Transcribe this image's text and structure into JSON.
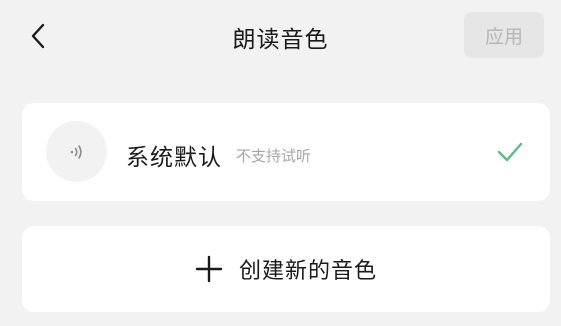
{
  "header": {
    "title": "朗读音色",
    "apply_label": "应用",
    "back_icon": "chevron-left-icon"
  },
  "voices": [
    {
      "name": "系统默认",
      "note": "不支持试听",
      "selected": true,
      "icon": "sound-wave-icon"
    }
  ],
  "create": {
    "label": "创建新的音色",
    "icon": "plus-icon"
  },
  "colors": {
    "background": "#f2f2f2",
    "card": "#ffffff",
    "check": "#5fb98a",
    "apply_disabled_bg": "#e6e6e6",
    "apply_disabled_text": "#b5b5b5"
  }
}
